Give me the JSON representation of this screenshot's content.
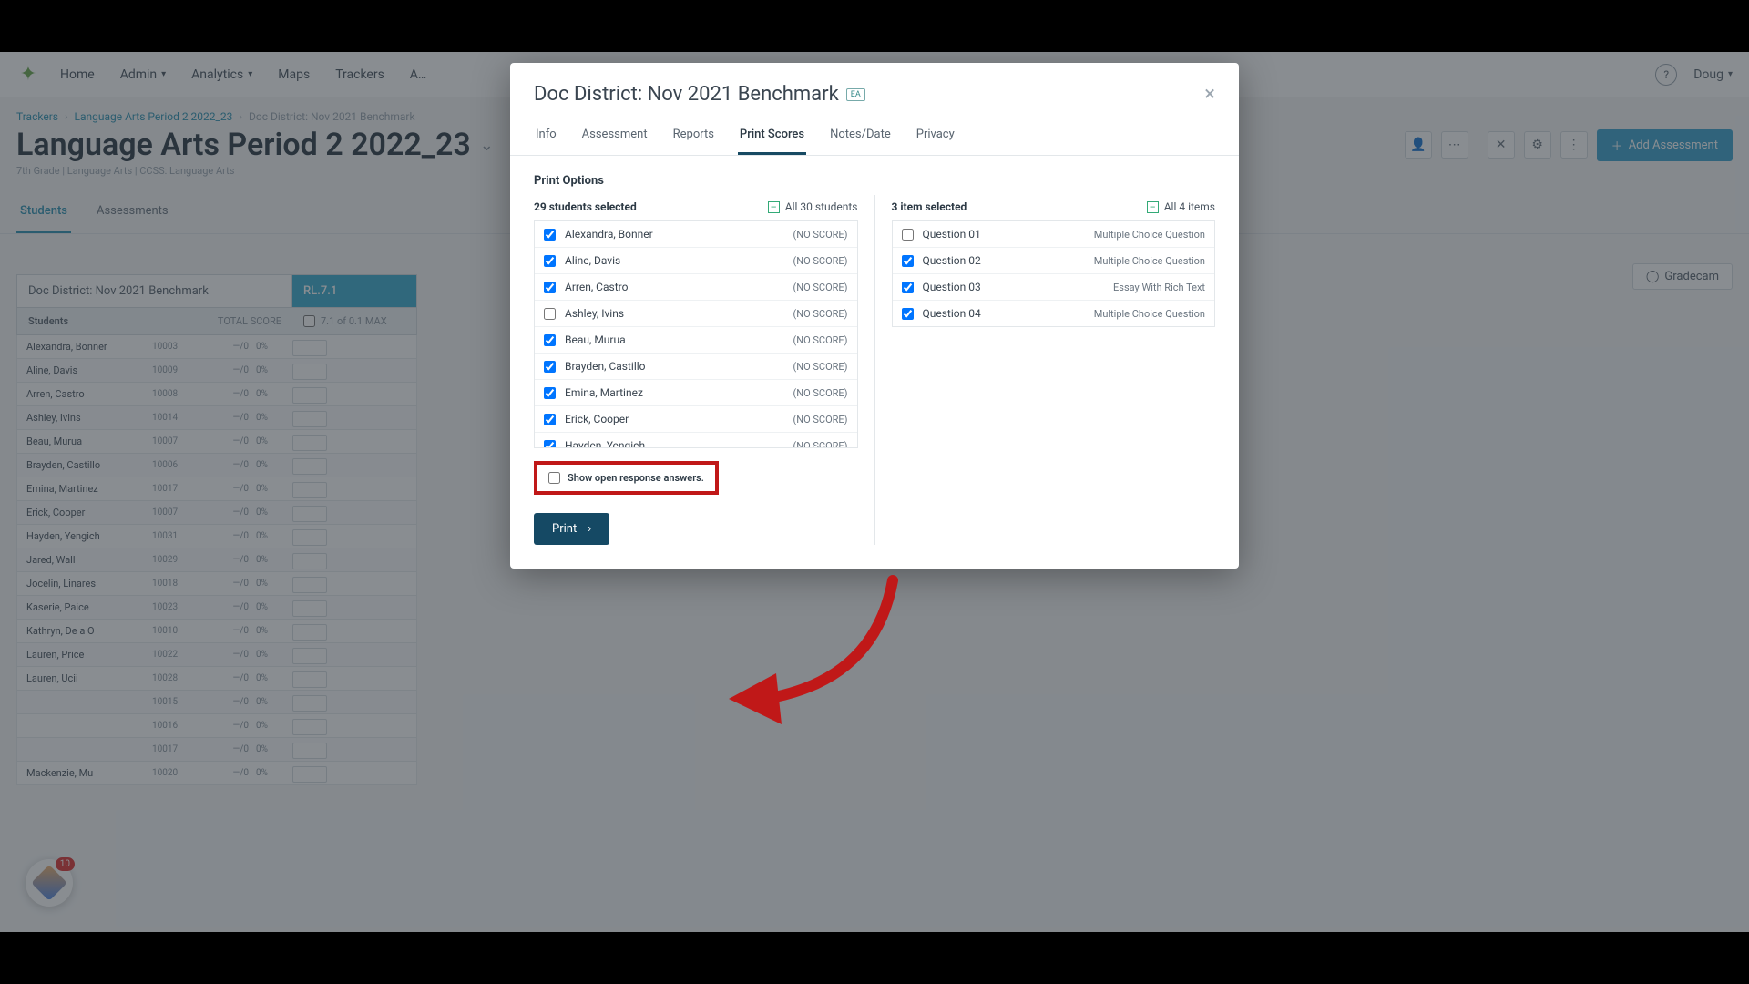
{
  "nav": {
    "items": [
      "Home",
      "Admin",
      "Analytics",
      "Maps",
      "Trackers"
    ],
    "user": "Doug"
  },
  "crumbs": {
    "a": "Trackers",
    "b": "Language Arts Period 2 2022_23",
    "c": "Doc District: Nov 2021 Benchmark"
  },
  "page": {
    "title": "Language Arts Period 2 2022_23",
    "subtitle": "7th Grade | Language Arts | CCSS: Language Arts",
    "add_btn": "Add Assessment",
    "tab_students": "Students",
    "tab_assessments": "Assessments",
    "gradecam": "Gradecam"
  },
  "table": {
    "assessment_name": "Doc District: Nov 2021 Benchmark",
    "code": "RL.7.1",
    "col_students": "Students",
    "col_totalscore": "TOTAL SCORE",
    "col_code": "7.1 of 0.1 MAX",
    "rows": [
      {
        "name": "Alexandra, Bonner",
        "id": "10003",
        "pts": "—/0",
        "pct": "0%"
      },
      {
        "name": "Aline, Davis",
        "id": "10009",
        "pts": "—/0",
        "pct": "0%"
      },
      {
        "name": "Arren, Castro",
        "id": "10008",
        "pts": "—/0",
        "pct": "0%"
      },
      {
        "name": "Ashley, Ivins",
        "id": "10014",
        "pts": "—/0",
        "pct": "0%"
      },
      {
        "name": "Beau, Murua",
        "id": "10007",
        "pts": "—/0",
        "pct": "0%"
      },
      {
        "name": "Brayden, Castillo",
        "id": "10006",
        "pts": "—/0",
        "pct": "0%"
      },
      {
        "name": "Emina, Martinez",
        "id": "10017",
        "pts": "—/0",
        "pct": "0%"
      },
      {
        "name": "Erick, Cooper",
        "id": "10007",
        "pts": "—/0",
        "pct": "0%"
      },
      {
        "name": "Hayden, Yengich",
        "id": "10031",
        "pts": "—/0",
        "pct": "0%"
      },
      {
        "name": "Jared, Wall",
        "id": "10029",
        "pts": "—/0",
        "pct": "0%"
      },
      {
        "name": "Jocelin, Linares",
        "id": "10018",
        "pts": "—/0",
        "pct": "0%"
      },
      {
        "name": "Kaserie, Paice",
        "id": "10023",
        "pts": "—/0",
        "pct": "0%"
      },
      {
        "name": "Kathryn, De a O",
        "id": "10010",
        "pts": "—/0",
        "pct": "0%"
      },
      {
        "name": "Lauren, Price",
        "id": "10022",
        "pts": "—/0",
        "pct": "0%"
      },
      {
        "name": "Lauren, Ucii",
        "id": "10028",
        "pts": "—/0",
        "pct": "0%"
      },
      {
        "name": "",
        "id": "10015",
        "pts": "—/0",
        "pct": "0%"
      },
      {
        "name": "",
        "id": "10016",
        "pts": "—/0",
        "pct": "0%"
      },
      {
        "name": "",
        "id": "10017",
        "pts": "—/0",
        "pct": "0%"
      },
      {
        "name": "Mackenzie, Mu",
        "id": "10020",
        "pts": "—/0",
        "pct": "0%"
      }
    ]
  },
  "badge": {
    "count": "10"
  },
  "modal": {
    "title": "Doc District: Nov 2021 Benchmark",
    "ea": "EA",
    "tabs": {
      "info": "Info",
      "assessment": "Assessment",
      "reports": "Reports",
      "print_scores": "Print Scores",
      "notes_date": "Notes/Date",
      "privacy": "Privacy"
    },
    "print_options": "Print Options",
    "students_selected": "29 students selected",
    "all_students": "All 30 students",
    "items_selected": "3 item selected",
    "all_items": "All 4 items",
    "no_score": "(NO SCORE)",
    "students": [
      {
        "name": "Alexandra, Bonner",
        "checked": true
      },
      {
        "name": "Aline, Davis",
        "checked": true
      },
      {
        "name": "Arren, Castro",
        "checked": true
      },
      {
        "name": "Ashley, Ivins",
        "checked": false
      },
      {
        "name": "Beau, Murua",
        "checked": true
      },
      {
        "name": "Brayden, Castillo",
        "checked": true
      },
      {
        "name": "Emina, Martinez",
        "checked": true
      },
      {
        "name": "Erick, Cooper",
        "checked": true
      },
      {
        "name": "Hayden, Yengich",
        "checked": true
      },
      {
        "name": "Jared, Wall",
        "checked": true
      }
    ],
    "questions": [
      {
        "name": "Question 01",
        "type": "Multiple Choice Question",
        "checked": false
      },
      {
        "name": "Question 02",
        "type": "Multiple Choice Question",
        "checked": true
      },
      {
        "name": "Question 03",
        "type": "Essay With Rich Text",
        "checked": true
      },
      {
        "name": "Question 04",
        "type": "Multiple Choice Question",
        "checked": true
      }
    ],
    "show_open": "Show open response answers.",
    "print_btn": "Print"
  }
}
